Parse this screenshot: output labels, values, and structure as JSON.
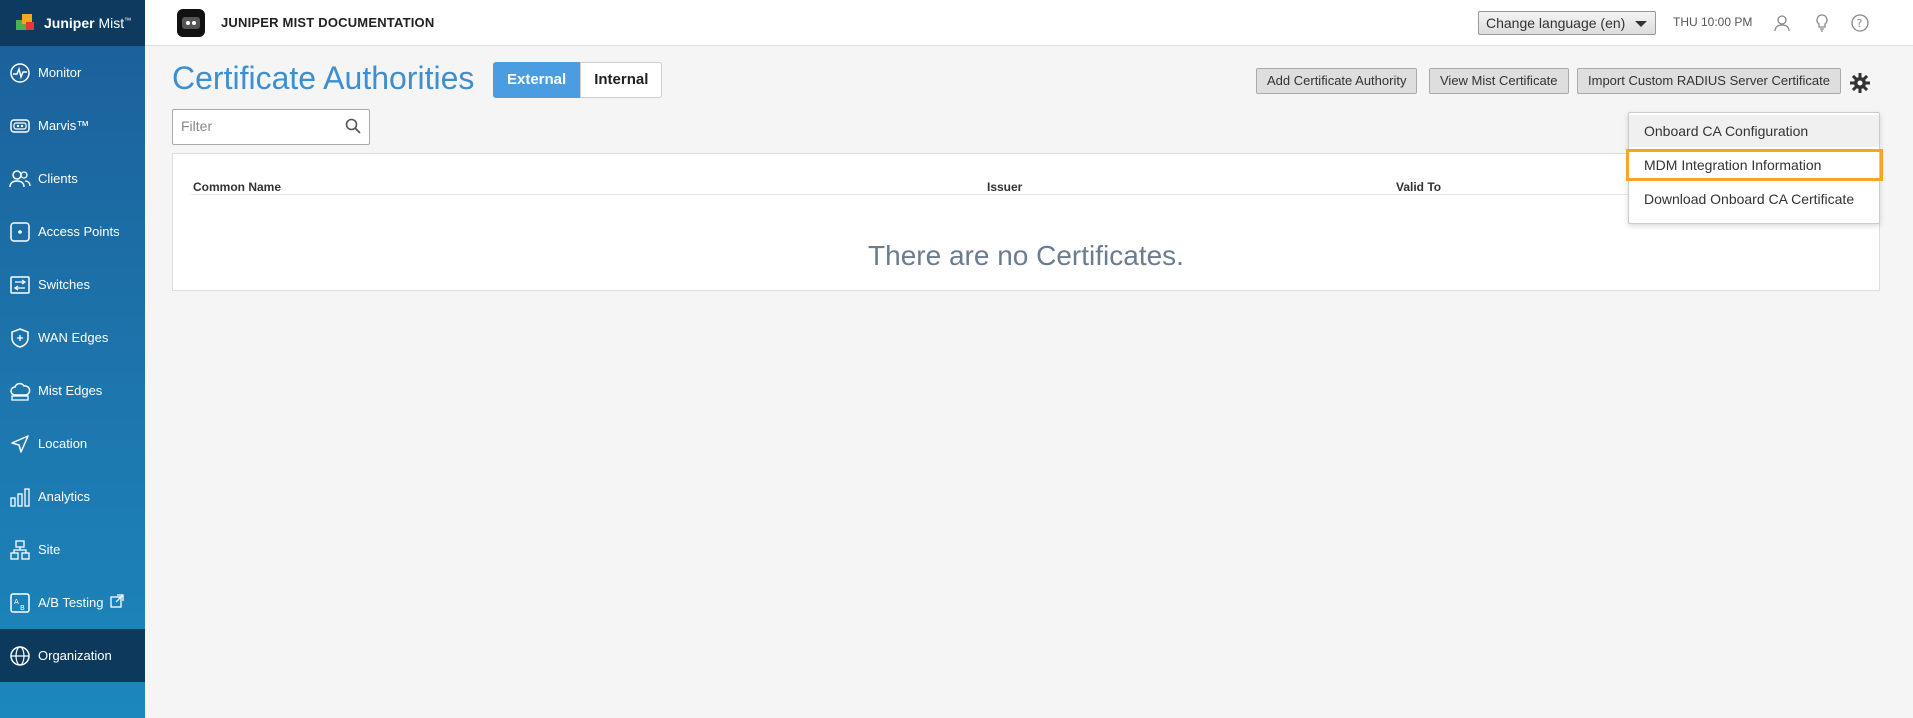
{
  "brand": {
    "name_bold": "Juniper",
    "name_light": " Mist",
    "trademark": "™"
  },
  "sidebar": {
    "items": [
      {
        "label": "Monitor",
        "icon": "monitor-icon"
      },
      {
        "label": "Marvis™",
        "icon": "marvis-icon"
      },
      {
        "label": "Clients",
        "icon": "clients-icon"
      },
      {
        "label": "Access Points",
        "icon": "access-points-icon"
      },
      {
        "label": "Switches",
        "icon": "switches-icon"
      },
      {
        "label": "WAN Edges",
        "icon": "wan-edges-icon"
      },
      {
        "label": "Mist Edges",
        "icon": "mist-edges-icon"
      },
      {
        "label": "Location",
        "icon": "location-icon"
      },
      {
        "label": "Analytics",
        "icon": "analytics-icon"
      },
      {
        "label": "Site",
        "icon": "site-icon"
      },
      {
        "label": "A/B Testing",
        "icon": "ab-testing-icon"
      },
      {
        "label": "Organization",
        "icon": "organization-icon",
        "active": true
      }
    ]
  },
  "header": {
    "org_name": "JUNIPER MIST DOCUMENTATION",
    "language_select": "Change language (en)",
    "clock": "THU 10:00 PM"
  },
  "main": {
    "title": "Certificate Authorities",
    "toggle": {
      "external": "External",
      "internal": "Internal",
      "selected": "External"
    },
    "buttons": {
      "add_ca": "Add Certificate Authority",
      "view_mist_cert": "View Mist Certificate",
      "import_radius": "Import Custom RADIUS Server Certificate"
    },
    "filter": {
      "placeholder": "Filter",
      "value": ""
    },
    "table": {
      "columns": [
        "Common Name",
        "Issuer",
        "Valid To"
      ],
      "rows": [],
      "empty_message": "There are no Certificates."
    },
    "settings_menu": {
      "items": [
        "Onboard CA Configuration",
        "MDM Integration Information",
        "Download Onboard CA Certificate"
      ],
      "highlighted": "MDM Integration Information"
    }
  },
  "colors": {
    "accent": "#3c8fd0",
    "toggle_active": "#4a9de0",
    "highlight_border": "#f5a623",
    "sidebar_active": "#0d3a5c"
  }
}
